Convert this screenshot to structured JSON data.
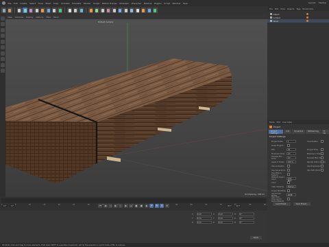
{
  "menu": {
    "items": [
      "File",
      "Edit",
      "Create",
      "Select",
      "Tools",
      "Mesh",
      "Snap",
      "Animate",
      "Simulate",
      "Render",
      "Sculpt",
      "Motion Tracker",
      "MoGraph",
      "Character",
      "Pipeline",
      "Plugins",
      "Script",
      "Window",
      "Help"
    ],
    "layout_label": "Layout:",
    "layout_value": "Startup"
  },
  "viewport": {
    "menu": [
      "View",
      "Cameras",
      "Display",
      "Options",
      "Filter",
      "Panel"
    ],
    "camera": "Default Camera",
    "grid_label": "Grid Spacing : 100 cm"
  },
  "object_manager": {
    "header": [
      "File",
      "Edit",
      "View",
      "Objects",
      "Tags",
      "Bookmarks"
    ],
    "rows": [
      "Object",
      "Lumber",
      "Wood"
    ]
  },
  "attributes": {
    "header": [
      "Mode",
      "Edit",
      "User Data"
    ],
    "title": "Project",
    "tabs": [
      "Project Settings",
      "Info",
      "Dynamics",
      "Referencing",
      "To Do"
    ],
    "section": "Project Settings",
    "rows": [
      {
        "label": "Project Scale",
        "value": "1",
        "right": "Centimeters"
      },
      {
        "label": "Scale Project...",
        "value": "",
        "right": ""
      },
      {
        "label": "FPS",
        "value": "30",
        "right": "Project Time"
      },
      {
        "label": "Minimum Time",
        "value": "0 F",
        "right": "Maximum Time"
      },
      {
        "label": "Preview Min Time",
        "value": "0 F",
        "right": "Preview Max Time"
      },
      {
        "label": "Level of Detail",
        "value": "100 %",
        "right": "Render LOD in Editor"
      },
      {
        "label": "Use Animation",
        "value": "",
        "right": "Use Expression"
      },
      {
        "label": "Use Generators",
        "value": "",
        "right": "Use Deformers"
      },
      {
        "label": "Use Motion System",
        "value": "",
        "right": ""
      },
      {
        "label": "Default Object Color",
        "value": "Gray Blue",
        "right": ""
      },
      {
        "label": "Color",
        "value": "",
        "right": ""
      },
      {
        "label": "View Clipping",
        "value": "Medium",
        "right": ""
      },
      {
        "label": "Linear Workflow",
        "value": "",
        "right": ""
      },
      {
        "label": "Input Color Profile",
        "value": "sRGB",
        "right": ""
      },
      {
        "label": "Use Color Channel for Node Material",
        "value": "",
        "right": ""
      }
    ],
    "buttons": [
      "Load Preset...",
      "Save Preset..."
    ]
  },
  "timeline": {
    "frames": [
      "0",
      "5",
      "10",
      "15",
      "20",
      "25",
      "30",
      "35",
      "40",
      "45",
      "50",
      "55",
      "60",
      "65",
      "70",
      "75",
      "80",
      "85",
      "90"
    ],
    "current_frame": "0 F",
    "start": "0 F",
    "end": "90 F",
    "end2": "90 F"
  },
  "coordinates": {
    "rows": [
      [
        "X",
        "0 cm",
        "X",
        "0 cm",
        "H",
        "0 °"
      ],
      [
        "Y",
        "0 cm",
        "Y",
        "0 cm",
        "P",
        "0 °"
      ],
      [
        "Z",
        "0 cm",
        "Z",
        "0 cm",
        "B",
        "0 °"
      ]
    ],
    "apply_label": "Apply"
  },
  "status": "00:00:01 Click and drag to move elements. Hold down SHIFT to quantize movement / add to the selection in point mode, CTRL to remove."
}
